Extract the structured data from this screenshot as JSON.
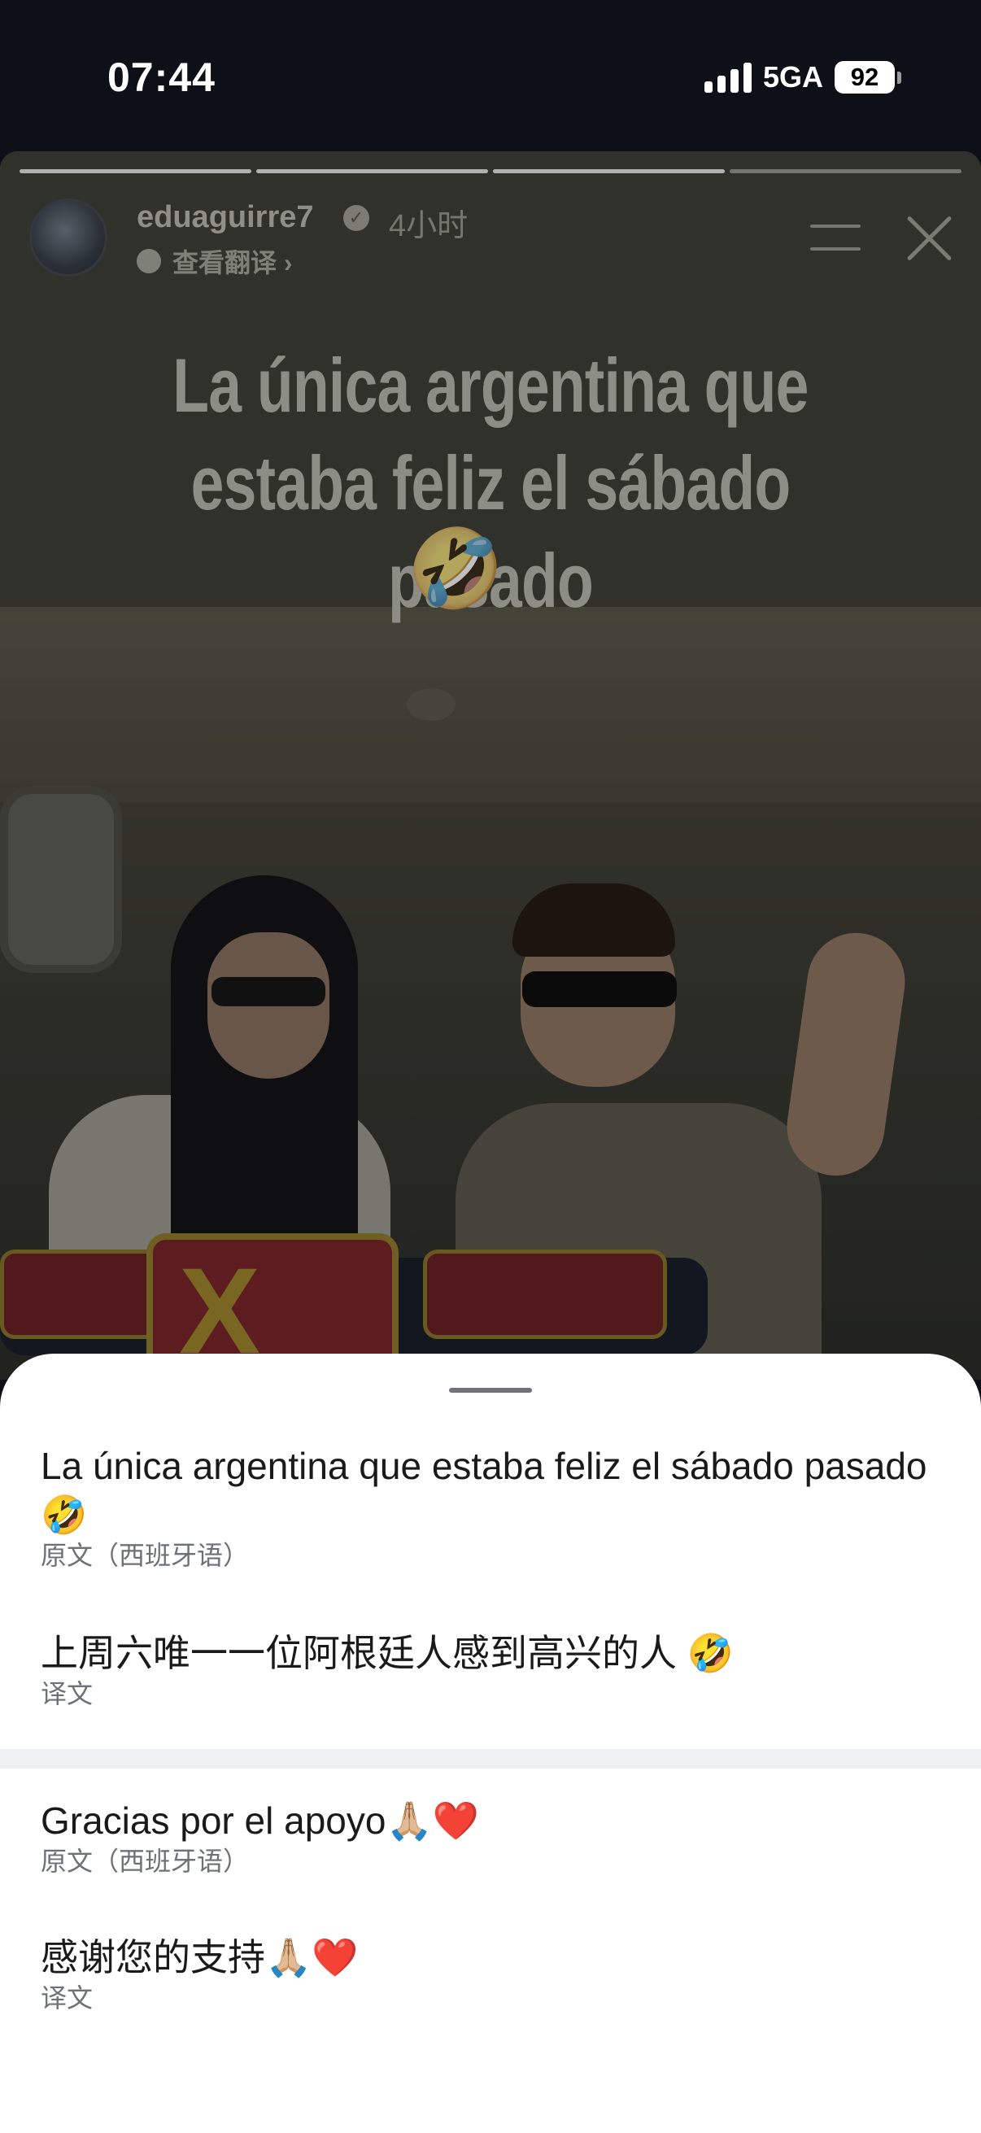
{
  "status_bar": {
    "time": "07:44",
    "network": "5GA",
    "battery": "92"
  },
  "story": {
    "username": "eduaguirre7",
    "time_ago": "4小时",
    "see_translation": "查看翻译 ›",
    "caption_line1": "La única argentina que",
    "caption_line2": "estaba feliz el sábado pasado",
    "caption_emoji": "🤣",
    "progress_segments": 4,
    "progress_done": 3
  },
  "sheet": {
    "items": [
      {
        "text": "La única argentina que estaba feliz el sábado pasado🤣",
        "sub": "原文（西班牙语）"
      },
      {
        "text": "上周六唯一一位阿根廷人感到高兴的人 🤣",
        "sub": "译文"
      },
      {
        "text": "Gracias por el apoyo🙏🏼❤️",
        "sub": "原文（西班牙语）"
      },
      {
        "text": "感谢您的支持🙏🏼❤️",
        "sub": "译文"
      }
    ]
  },
  "icons": {
    "verified": "verified-badge-icon",
    "translate": "speech-bubble-icon",
    "menu": "menu-icon",
    "close": "close-icon"
  }
}
